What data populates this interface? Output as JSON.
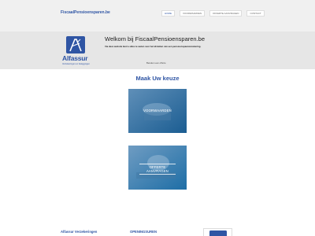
{
  "header": {
    "site_title": "FiscaalPensioensparen.be",
    "nav": [
      "HOME",
      "VOORWAARDEN",
      "OFFERTE AANVRAGEN",
      "CONTACT"
    ]
  },
  "logo": {
    "name": "Alfassur",
    "tagline": "Verzekeringen en beleggingen"
  },
  "welcome": {
    "title": "Welkom bij FiscaalPensioensparen.be",
    "text": "Via deze website kunt u alles te weten over het afsluiten van een pensioenspaarverzekering.",
    "link": "Bereken een offerte"
  },
  "main": {
    "section_title": "Maak Uw keuze",
    "cards": [
      "VOORWAARDEN",
      "OFFERTE AANVRAGEN"
    ]
  },
  "footer": {
    "col1_title": "Alfassur Verzekeringen",
    "col2_title": "OPENINGSUREN"
  },
  "colors": {
    "brand": "#2f55a4",
    "header_bg": "#f0f0f0",
    "intro_bg": "#e6e6e6"
  }
}
